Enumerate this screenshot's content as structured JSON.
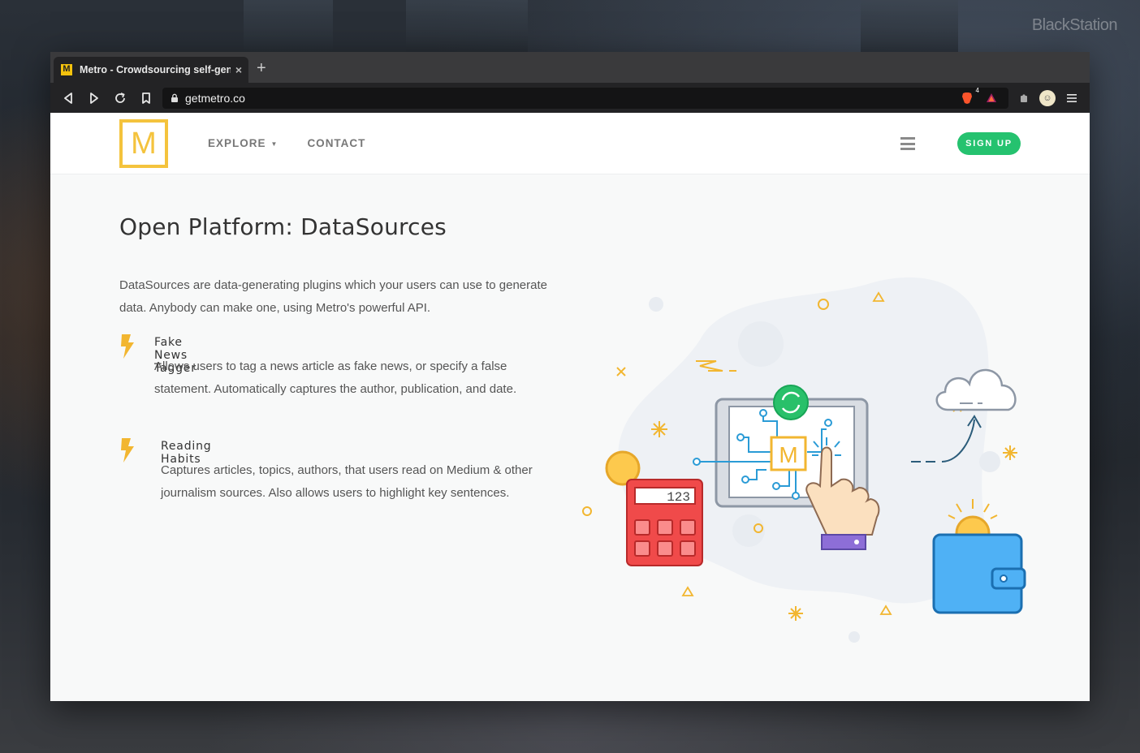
{
  "desktop": {
    "watermark": "BlackStation"
  },
  "browser": {
    "tab": {
      "favicon": "M",
      "title": "Metro - Crowdsourcing self-gen",
      "close": "×"
    },
    "newtab": "+",
    "url": "getmetro.co",
    "brave_count": "4"
  },
  "site": {
    "logo": "M",
    "nav": {
      "explore": "EXPLORE",
      "contact": "CONTACT"
    },
    "signup": "SIGN UP"
  },
  "main": {
    "title": "Open Platform: DataSources",
    "intro": "DataSources are data-generating plugins which your users can use to generate data. Anybody can make one, using Metro's powerful API.",
    "features": [
      {
        "title": "Fake News Tagger",
        "description": "Allows users to tag a news article as fake news, or specify a false statement. Automatically captures the author, publication, and date."
      },
      {
        "title": "Reading Habits",
        "description": "Captures articles, topics, authors, that users read on Medium & other journalism sources. Also allows users to highlight key sentences."
      }
    ],
    "illustration": {
      "calculator_display": "123",
      "tablet_logo": "M"
    }
  },
  "colors": {
    "brand_yellow": "#f4c33d",
    "signup_green": "#25c26f",
    "bolt": "#f2b630"
  }
}
